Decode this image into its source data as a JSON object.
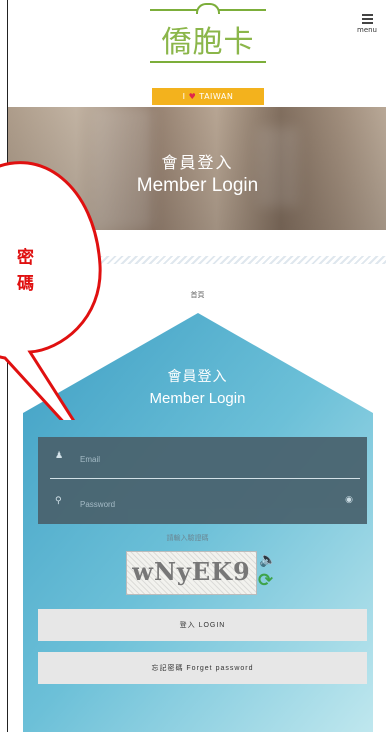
{
  "header": {
    "logo_name": "僑胞卡",
    "ribbon_prefix": "I",
    "ribbon_suffix": "TAIWAN",
    "menu_label": "menu"
  },
  "hero": {
    "title_zh": "會員登入",
    "title_en": "Member Login"
  },
  "breadcrumb": "首頁",
  "panel": {
    "title_zh": "會員登入",
    "title_en": "Member Login"
  },
  "form": {
    "email_placeholder": "Email",
    "password_placeholder": "Password"
  },
  "captcha": {
    "label": "請輸入驗證碼",
    "code": "wNyEK9"
  },
  "buttons": {
    "login": "登入 LOGIN",
    "forgot": "忘記密碼 Forget password"
  },
  "callout": {
    "line1": "密",
    "line2": "碼"
  },
  "colors": {
    "brand_green": "#8bb64a",
    "ribbon_yellow": "#f3b21d",
    "panel_blue": "#5cb0d0",
    "callout_red": "#e01010"
  }
}
